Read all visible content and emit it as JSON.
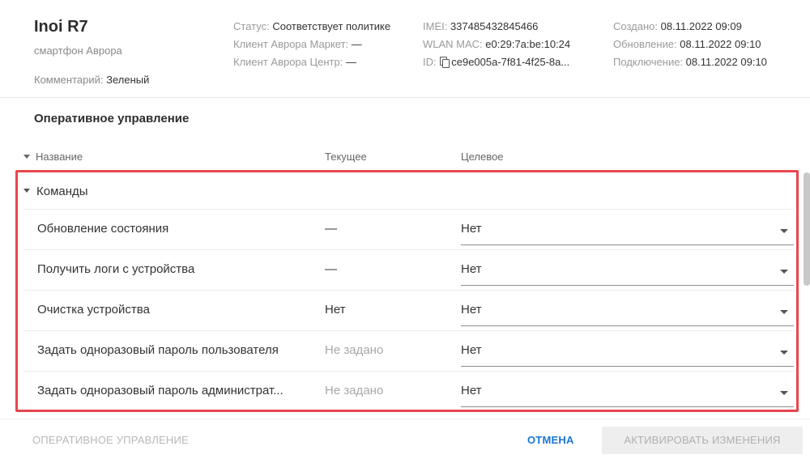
{
  "device": {
    "name": "Inoi R7",
    "type": "смартфон Аврора",
    "comment_label": "Комментарий: ",
    "comment_value": "Зеленый"
  },
  "info": {
    "status_label": "Статус: ",
    "status_value": "Соответствует политике",
    "market_label": "Клиент Аврора Маркет: ",
    "market_value": "—",
    "center_label": "Клиент Аврора Центр: ",
    "center_value": "—",
    "imei_label": "IMEI: ",
    "imei_value": "337485432845466",
    "wlan_label": "WLAN MAC: ",
    "wlan_value": "e0:29:7a:be:10:24",
    "id_label": "ID: ",
    "id_value": "ce9e005a-7f81-4f25-8a...",
    "created_label": "Создано: ",
    "created_value": "08.11.2022 09:09",
    "updated_label": "Обновление: ",
    "updated_value": "08.11.2022 09:10",
    "connected_label": "Подключение: ",
    "connected_value": "08.11.2022 09:10"
  },
  "section_title": "Оперативное управление",
  "columns": {
    "name": "Название",
    "current": "Текущее",
    "target": "Целевое"
  },
  "group": {
    "title": "Команды",
    "rows": [
      {
        "name": "Обновление состояния",
        "current": "—",
        "target": "Нет"
      },
      {
        "name": "Получить логи с устройства",
        "current": "—",
        "target": "Нет"
      },
      {
        "name": "Очистка устройства",
        "current": "Нет",
        "target": "Нет"
      },
      {
        "name": "Задать одноразовый пароль пользователя",
        "current": "Не задано",
        "target": "Нет"
      },
      {
        "name": "Задать одноразовый пароль администрат...",
        "current": "Не задано",
        "target": "Нет"
      }
    ]
  },
  "footer": {
    "left_label": "ОПЕРАТИВНОЕ УПРАВЛЕНИЕ",
    "cancel_label": "ОТМЕНА",
    "activate_label": "АКТИВИРОВАТЬ ИЗМЕНЕНИЯ"
  },
  "colors": {
    "accent": "#1976d2",
    "highlight": "#e8464e"
  }
}
